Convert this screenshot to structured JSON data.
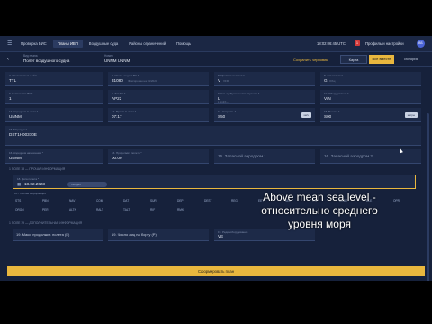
{
  "topnav": {
    "items": [
      "Проверка БИС",
      "Планы ИВП",
      "Воздушные суда",
      "Районы ограничений",
      "Помощь"
    ],
    "active_index": 1,
    "clock": "18:02:06:45 UTC",
    "notif_count": "1",
    "profile": "Профиль и настройки",
    "avatar": "ВБ"
  },
  "subheader": {
    "type_label": "Вид плана",
    "type_value": "Полет воздушного судна",
    "reg_label": "Номер",
    "reg_value": "UNNM UNNM",
    "save_draft": "Сохранить черновик",
    "map_btn": "Карта",
    "all_btn": "Всё вместе",
    "history_btn": "История"
  },
  "fields": {
    "f7_label": "7. Опознавательный *",
    "f7_value": "TTL",
    "f8_label": "8. Опозн. индекс ВС *",
    "f8_value": "31080",
    "f8_hint": "Фиксирован на 01/2024",
    "f8a_label": "8. Правила полетов *",
    "f8a_value": "V",
    "f8a_hint": "VFR",
    "f8b_label": "8. Тип полета *",
    "f8b_value": "G",
    "f8b_hint": "Общ",
    "f9a_label": "9. Количество ВС *",
    "f9a_value": "1",
    "f9b_label": "9. Тип ВС *",
    "f9b_value": "AP22",
    "f9c_label": "9. Кат. турбулентности спутного *",
    "f9c_value": "L",
    "f9c_hint": "L (Light) ~",
    "f10_label": "10. Оборудование *",
    "f10_value": "V/N",
    "f13a_label": "13. Аэродром вылета *",
    "f13a_value": "UNNM",
    "f13b_label": "13. Время вылета *",
    "f13b_value": "07:17",
    "f15a_label": "15. Скорость *",
    "f15a_value": "S50",
    "f15a_btn": "км/ч",
    "f15b_label": "15. Высота *",
    "f15b_value": "S00",
    "f15b_btn": "метры",
    "f15c_label": "15. Маршрут *",
    "f15c_value": "DST1H00370E",
    "f16a_label": "16. Аэродром назначения *",
    "f16a_value": "UNNM",
    "f16b_label": "16. Продолжит. полета *",
    "f16b_value": "00:00",
    "f16c_label": "16. Запасной аэродром 1",
    "f16c_value": "",
    "f16d_label": "16. Запасной аэродром 2",
    "f16d_value": ""
  },
  "section18": {
    "title": "1   ПОЛЕ 18 — ПРОЧАЯ ИНФОРМАЦИЯ",
    "dof_label": "18. Дата полета *",
    "dof_value": "18.02.2023",
    "dof_pill": "Сегодня",
    "subtitle": "18 / Прочая информация",
    "chips": [
      "STS",
      "PBN",
      "NAV",
      "COM",
      "DAT",
      "SUR",
      "DEP",
      "DEST",
      "REG",
      "EET",
      "SEL",
      "TYP",
      "CODE",
      "DLE",
      "OPR",
      "ORGN",
      "PER",
      "ALTN",
      "RALT",
      "TALT",
      "RIF",
      "RMK"
    ]
  },
  "section19": {
    "title": "1   ПОЛЕ 19 — ДОПОЛНИТЕЛЬНАЯ ИНФОРМАЦИЯ",
    "f19a_label": "19. Макс. продолжит. полета (E)",
    "f19b_label": "19. Число лиц на борту (P)",
    "f19c_label": "19. Радиооборудование",
    "f19c_value": "VE",
    "f19d_label": "19. Спасательное оборудование (S)",
    "f19d_value": ""
  },
  "overlay": {
    "line1": "Above mean sea level -",
    "line2": "относительно среднего",
    "line3": "уровня моря"
  },
  "submit": "Сформировать план"
}
